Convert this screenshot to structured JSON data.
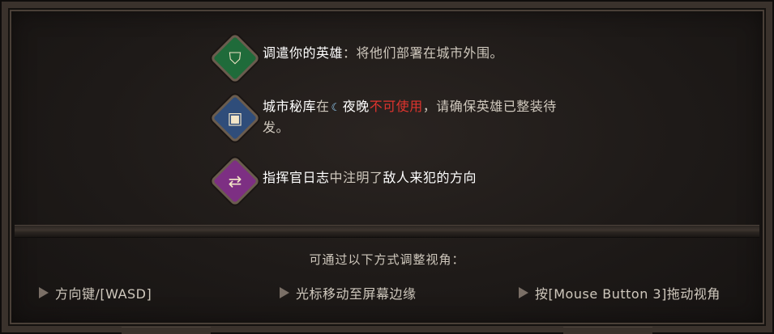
{
  "dispatch": {
    "icon": "spartan-helmet-icon",
    "lead": "调遣你的英雄",
    "rest": "：将他们部署在城市外围。"
  },
  "vault": {
    "icon": "treasure-chest-icon",
    "lead": "城市秘库",
    "mid": "在",
    "night": "夜晚",
    "warn": "不可使用",
    "rest": "，请确保英雄已整装待发。"
  },
  "log": {
    "icon": "crossed-arrows-icon",
    "lead": "指挥官日志",
    "mid": "中注明了",
    "enemy": "敌人来犯的方向"
  },
  "camera": {
    "title": "可通过以下方式调整视角：",
    "hints": [
      "方向键/[WASD]",
      "光标移动至屏幕边缘",
      "按[Mouse Button 3]拖动视角"
    ]
  },
  "colors": {
    "warning": "#e0342e",
    "green_icon": "#1f6b3a",
    "blue_icon": "#2f4d7a",
    "purple_icon": "#7d2f83"
  }
}
